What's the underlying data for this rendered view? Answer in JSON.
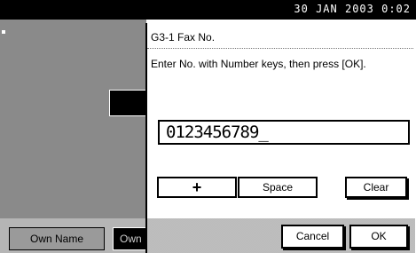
{
  "status": {
    "datetime": "30  JAN  2003  0:02"
  },
  "background": {
    "own_name_label": "Own Name",
    "own_partial_label": "Own"
  },
  "dialog": {
    "title": "G3-1 Fax No.",
    "instruction": "Enter No. with Number keys, then press [OK].",
    "number_value": "0123456789_",
    "buttons": {
      "plus": "+",
      "space": "Space",
      "clear": "Clear",
      "cancel": "Cancel",
      "ok": "OK"
    }
  }
}
